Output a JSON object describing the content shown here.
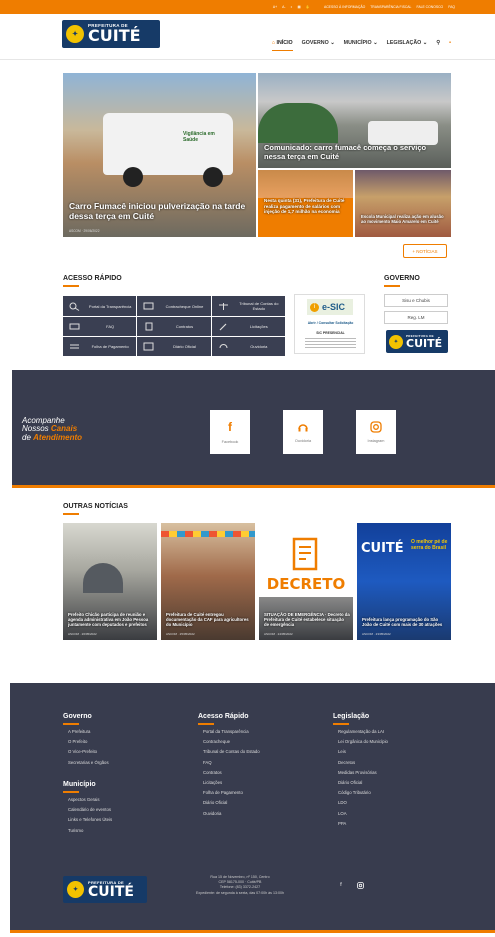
{
  "topbar": {
    "links": [
      "ACESSO À INFORMAÇÃO",
      "TRANSPARÊNCIA FISCAL",
      "FALE CONOSCO",
      "FAQ"
    ]
  },
  "brand": {
    "small": "PREFEITURA DE",
    "big": "CUITÉ"
  },
  "nav": {
    "items": [
      "INÍCIO",
      "GOVERNO",
      "MUNICÍPIO",
      "LEGISLAÇÃO"
    ]
  },
  "slides": [
    {
      "title": "Carro Fumacê iniciou pulverização na tarde dessa terça em Cuité",
      "meta": "ASCOM · 29/06/2022",
      "van_text": "Vigilância em Saúde"
    },
    {
      "title": "Comunicado: carro fumacê começa o serviço nessa terça em Cuité"
    },
    {
      "title": "Nesta quinta (31), Prefeitura de Cuité realiza pagamento de salários com injeção de 1,7 milhão na economia"
    },
    {
      "title": "Escola Municipal realiza ação em alusão ao movimento Maio Amarelo em Cuité"
    }
  ],
  "more_button": "+ NOTÍCIAS",
  "quick_access": {
    "title": "ACESSO RÁPIDO",
    "items": [
      "Portal da Transparência",
      "Contracheque Online",
      "Tribunal de Contas do Estado",
      "FAQ",
      "Contratos",
      "Licitações",
      "Folha de Pagamento",
      "Diário Oficial",
      "Ouvidoria"
    ]
  },
  "esic": {
    "logo": "e-SIC",
    "subtitle": "Abrir / Consultar Solicitação",
    "heading": "SIC PRESENCIAL"
  },
  "governo": {
    "title": "GOVERNO",
    "buttons": [
      "Sisu e Chubis",
      "Reg. LM"
    ]
  },
  "channels": {
    "line1": "Acompanhe",
    "line2a": "Nossos ",
    "line2b": "Canais",
    "line3a": "de ",
    "line3b": "Atendimento",
    "cards": [
      "Facebook",
      "Ouvidoria",
      "Instagram"
    ]
  },
  "other_news": {
    "title": "OUTRAS NOTÍCIAS",
    "items": [
      {
        "title": "Prefeito Chicão participa de reunião e agenda administrativa em João Pessoa juntamente com deputados e prefeitos",
        "meta": "ASCOM · 26/05/2022"
      },
      {
        "title": "Prefeitura de Cuité entregou documentação da CAF para agricultores do Município",
        "meta": "ASCOM · 25/05/2022"
      },
      {
        "title": "SITUAÇÃO DE EMERGÊNCIA · Decreto da Prefeitura de Cuité estabelece situação de emergência",
        "meta": "ASCOM · 24/05/2022",
        "banner": "DECRETO"
      },
      {
        "title": "Prefeitura lança programação do São João de Cuité com mais de 30 atrações",
        "meta": "ASCOM · 23/05/2022",
        "banner1": "CUITÉ",
        "banner2": "O melhor pé de serra do Brasil"
      }
    ]
  },
  "footer": {
    "col1": {
      "title": "Governo",
      "items": [
        "A Prefeitura",
        "O Prefeito",
        "O Vice-Prefeito",
        "Secretarias e Órgãos"
      ]
    },
    "col1b": {
      "title": "Município",
      "items": [
        "Aspectos Gerais",
        "Calendário de eventos",
        "Links e Telefones Úteis",
        "Turismo"
      ]
    },
    "col2": {
      "title": "Acesso Rápido",
      "items": [
        "Portal da Transparência",
        "Contracheque",
        "Tribunal de Contas do Estado",
        "FAQ",
        "Contratos",
        "Licitações",
        "Folha de Pagamento",
        "Diário Oficial",
        "Ouvidoria"
      ]
    },
    "col3": {
      "title": "Legislação",
      "items": [
        "Regulamentação da LAI",
        "Lei Orgânica do Município",
        "Leis",
        "Decretos",
        "Medidas Provisórias",
        "Diário Oficial",
        "Código Tributário",
        "LDO",
        "LOA",
        "PPA"
      ]
    },
    "address": [
      "Rua 15 de Novembro, nº 150, Centro",
      "CEP 58175-000 · Cuité/PB",
      "Telefone: (83) 3372-2427",
      "Expediente: de segunda à sexta, das 07:00h às 13:00h"
    ]
  },
  "colors": {
    "accent": "#ef7d00",
    "dark": "#383c4e",
    "brand": "#163a67"
  }
}
